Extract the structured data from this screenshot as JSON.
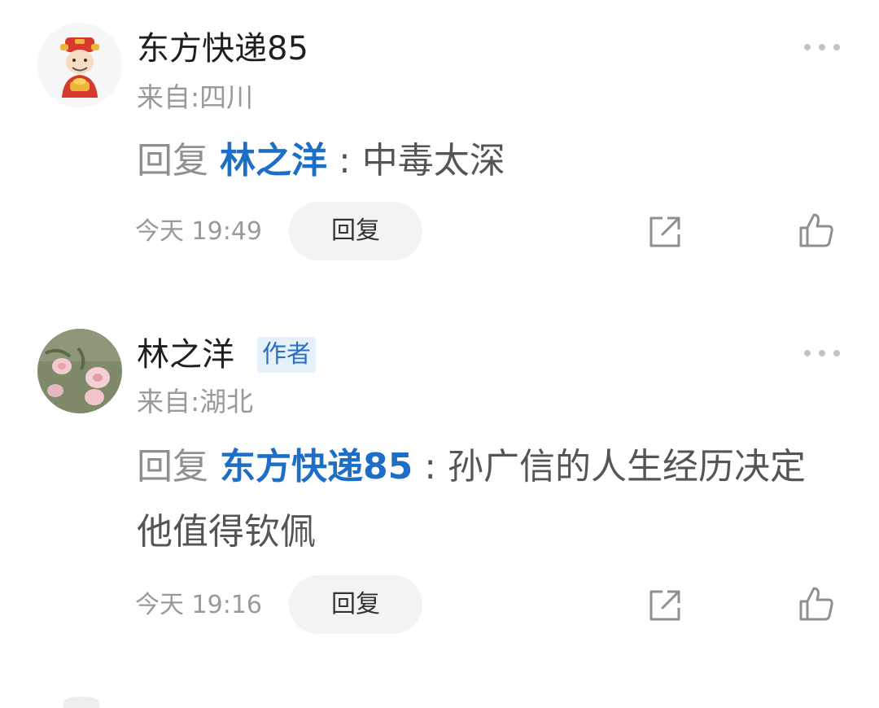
{
  "comments": [
    {
      "username": "东方快递85",
      "location": "来自:四川",
      "reply_word": "回复",
      "mention": "林之洋",
      "colon": " : ",
      "text": "中毒太深",
      "time": "今天 19:49",
      "reply_button": "回复",
      "icons": [
        "god-of-wealth-avatar",
        "more-icon",
        "share-icon",
        "like-icon"
      ]
    },
    {
      "username": "林之洋",
      "badge": "作者",
      "location": "来自:湖北",
      "reply_word": "回复",
      "mention": "东方快递85",
      "colon": " : ",
      "text": "孙广信的人生经历决定他值得钦佩",
      "time": "今天 19:16",
      "reply_button": "回复",
      "icons": [
        "flowers-avatar",
        "more-icon",
        "share-icon",
        "like-icon"
      ]
    }
  ],
  "colors": {
    "mention": "#1d6ec7",
    "badge_text": "#2f6fc0",
    "badge_bg": "#e6f0fb",
    "reply_button_bg": "#f2f3f5",
    "muted_text": "#9a9a9a"
  }
}
